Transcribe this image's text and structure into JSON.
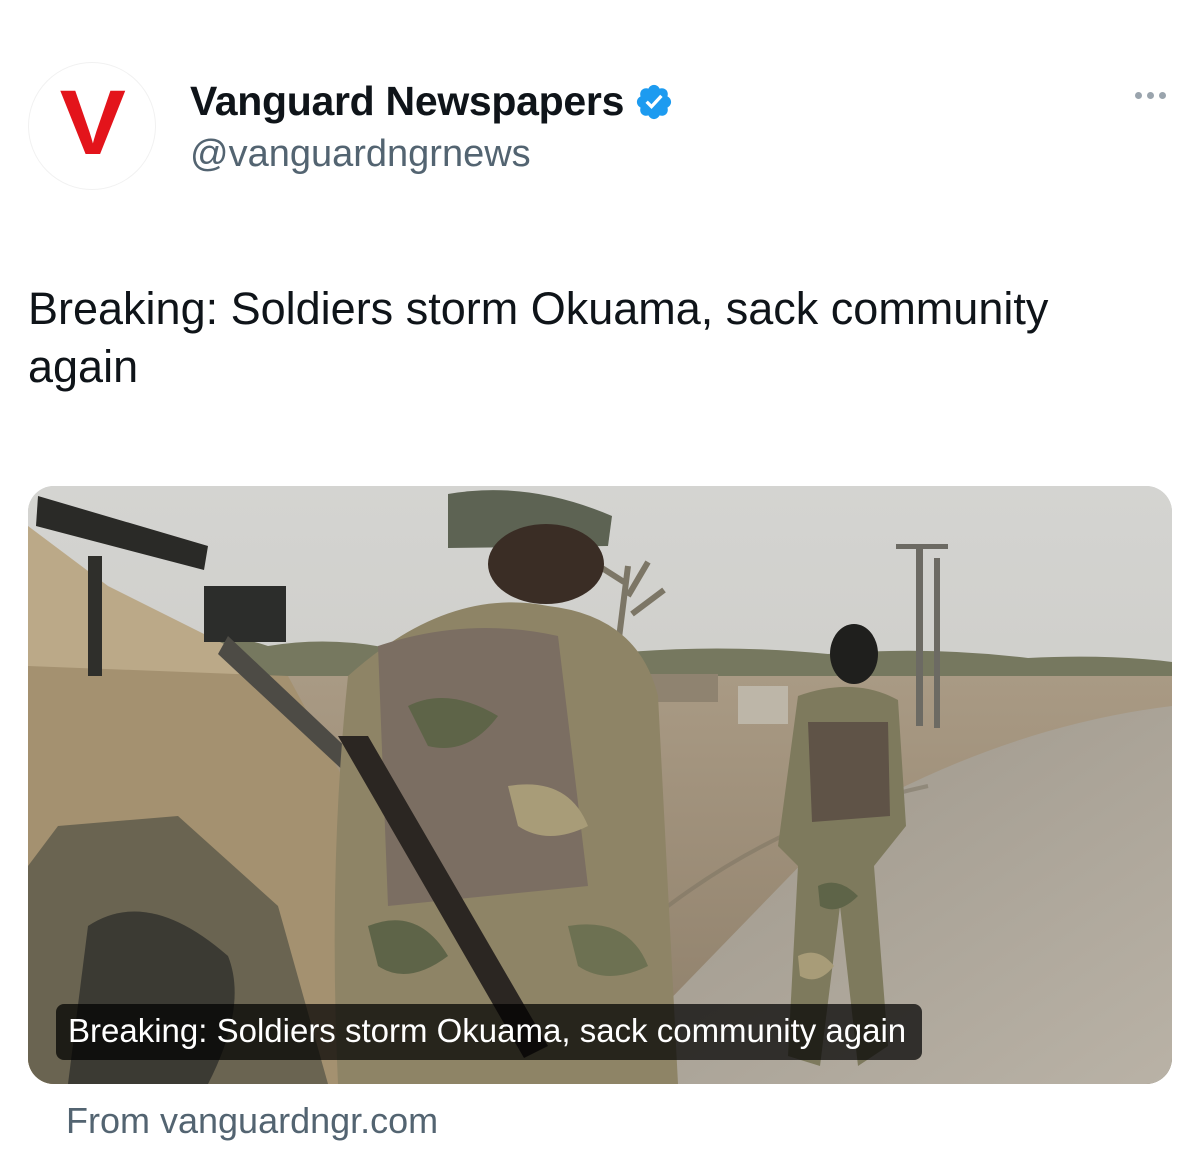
{
  "author": {
    "avatar_letter": "V",
    "display_name": "Vanguard Newspapers",
    "handle": "@vanguardngrnews",
    "verified": true,
    "brand_color": "#e3141b",
    "verified_color": "#1d9bf0"
  },
  "tweet": {
    "text": "Breaking: Soldiers storm Okuama, sack community again"
  },
  "card": {
    "caption": "Breaking: Soldiers storm Okuama, sack community again",
    "source": "From vanguardngr.com",
    "image_subject": "soldiers-on-rural-road-photo"
  },
  "menu": {
    "icon": "more-dots-icon"
  }
}
